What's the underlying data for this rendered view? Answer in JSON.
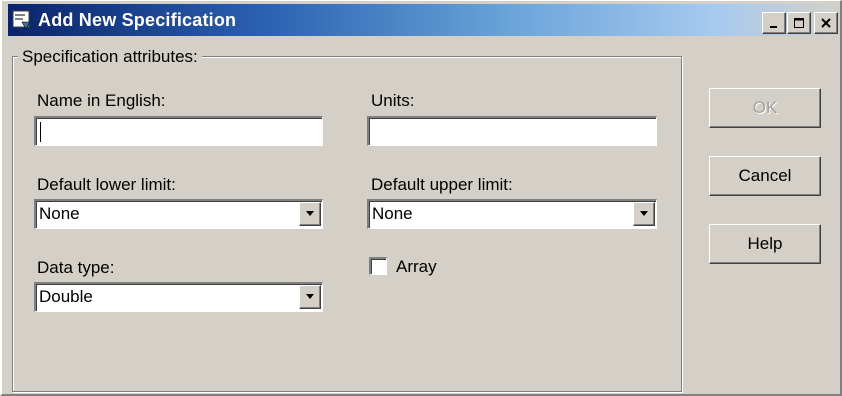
{
  "window": {
    "title": "Add New Specification",
    "minimize_label": "_",
    "close_label": "×"
  },
  "group": {
    "legend": "Specification attributes:"
  },
  "fields": {
    "name_label": "Name in English:",
    "name_value": "",
    "units_label": "Units:",
    "units_value": "",
    "lower_label": "Default lower limit:",
    "lower_value": "None",
    "upper_label": "Default upper limit:",
    "upper_value": "None",
    "datatype_label": "Data type:",
    "datatype_value": "Double",
    "array_label": "Array",
    "array_checked": false
  },
  "buttons": {
    "ok": "OK",
    "cancel": "Cancel",
    "help": "Help"
  },
  "icons": [
    "app-icon",
    "minimize-icon",
    "maximize-icon",
    "close-icon",
    "chevron-down-icon"
  ],
  "colors": {
    "title_start": "#0a246a",
    "face": "#d4d0c8"
  }
}
